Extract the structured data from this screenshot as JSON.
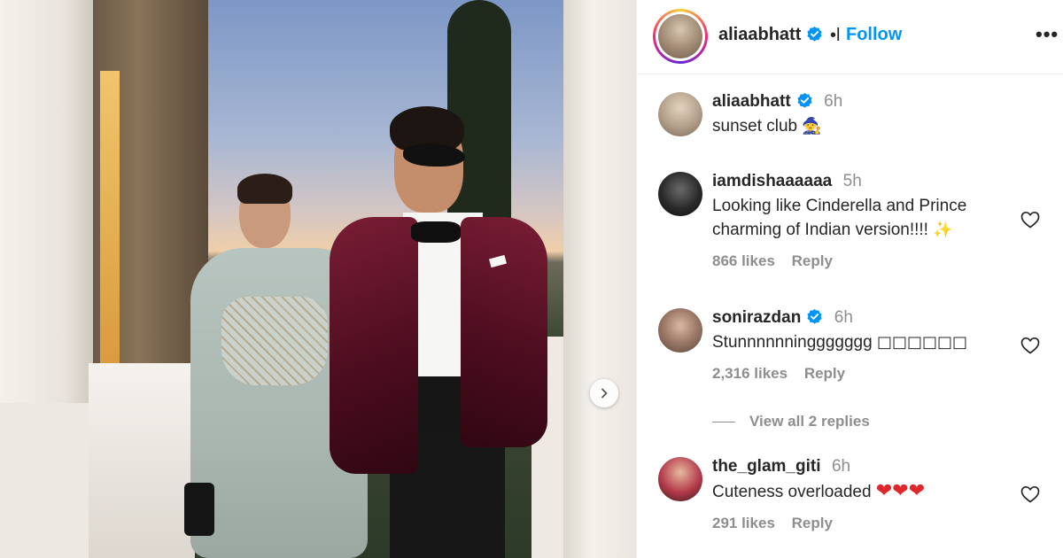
{
  "post": {
    "author": "aliaabhatt",
    "separator": "•l",
    "follow_label": "Follow",
    "more_label": "•••",
    "next_icon": "chevron-right-icon"
  },
  "comments": [
    {
      "username": "aliaabhatt",
      "verified": true,
      "time": "6h",
      "text": "sunset club",
      "emoji": "🧙",
      "likes": "",
      "reply": ""
    },
    {
      "username": "iamdishaaaaaa",
      "verified": false,
      "time": "5h",
      "text": "Looking like Cinderella and Prince charming of Indian version!!!!",
      "emoji": "✨",
      "likes": "866 likes",
      "reply": "Reply"
    },
    {
      "username": "sonirazdan",
      "verified": true,
      "time": "6h",
      "text": "Stunnnnnninggggggg",
      "emoji": "□□□□□□",
      "likes": "2,316 likes",
      "reply": "Reply"
    },
    {
      "username": "the_glam_giti",
      "verified": false,
      "time": "6h",
      "text": "Cuteness overloaded",
      "emoji": "❤❤❤",
      "likes": "291 likes",
      "reply": "Reply"
    }
  ],
  "view_replies_label": "View all 2 replies",
  "colors": {
    "link_blue": "#0095f6",
    "verified_blue": "#0095f6",
    "muted_text": "#8e8e8e",
    "heart_red": "#e0262b"
  }
}
